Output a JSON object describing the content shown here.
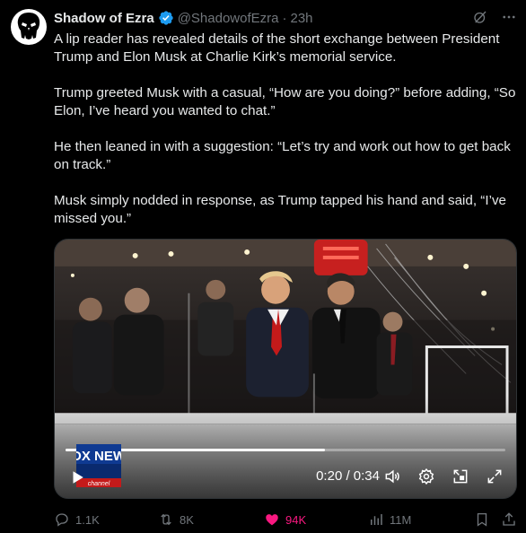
{
  "author": {
    "name": "Shadow of Ezra",
    "handle": "@ShadowofEzra",
    "separator": "·",
    "time": "23h"
  },
  "tweet": {
    "paragraphs": [
      "A lip reader has revealed details of the short exchange between President Trump and Elon Musk at Charlie Kirk’s memorial service.",
      "Trump greeted Musk with a casual, “How are you doing?” before adding, “So Elon, I’ve heard you wanted to chat.”",
      "He then leaned in with a suggestion: “Let’s try and work out how to get back on track.”",
      "Musk simply nodded in response, as Trump tapped his hand and said, “I’ve missed you.”"
    ]
  },
  "video": {
    "time": "0:20 / 0:34",
    "progress": 0.59,
    "logo_text": "FOX NEWS",
    "logo_subtext": "channel"
  },
  "actions": {
    "replies": "1.1K",
    "reposts": "8K",
    "likes": "94K",
    "views": "11M"
  },
  "colors": {
    "background": "#000000",
    "text": "#e7e9ea",
    "muted": "#71767b",
    "verified": "#1d9bf0",
    "like": "#f91880"
  },
  "icons": [
    "verified-badge-icon",
    "grok-icon",
    "more-icon",
    "play-icon",
    "volume-icon",
    "settings-icon",
    "pip-icon",
    "fullscreen-icon",
    "reply-icon",
    "repost-icon",
    "like-icon",
    "views-icon",
    "bookmark-icon",
    "share-icon"
  ]
}
